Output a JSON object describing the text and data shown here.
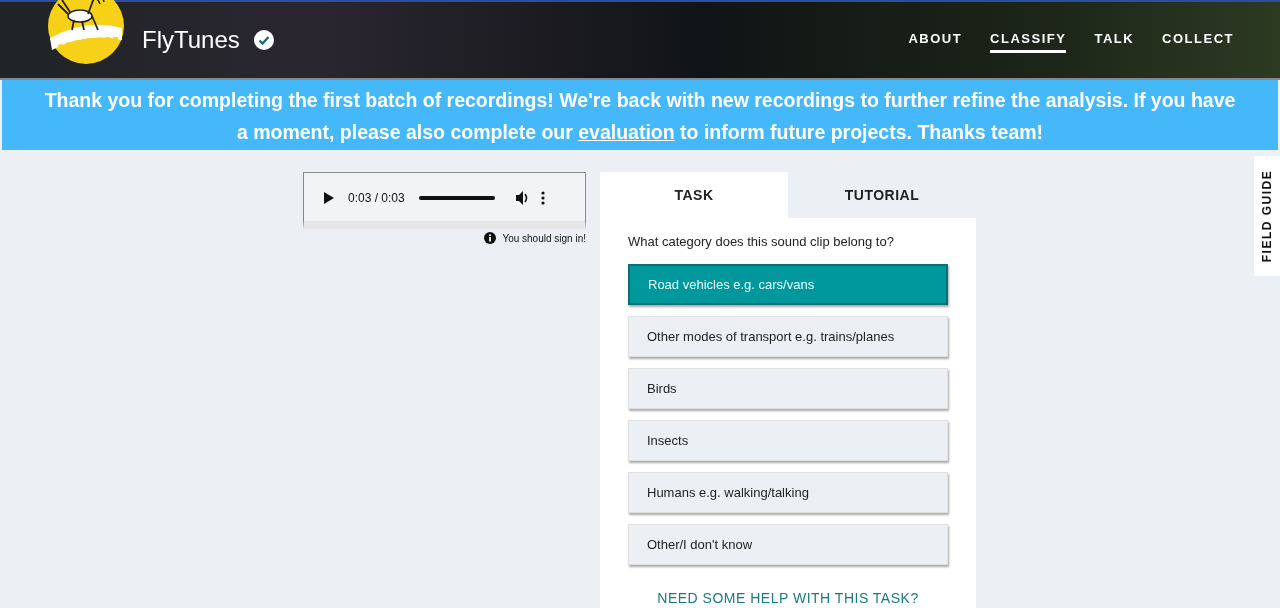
{
  "header": {
    "title": "FlyTunes",
    "verified": true,
    "nav": [
      {
        "label": "ABOUT",
        "selected": false
      },
      {
        "label": "CLASSIFY",
        "selected": true
      },
      {
        "label": "TALK",
        "selected": false
      },
      {
        "label": "COLLECT",
        "selected": false
      }
    ]
  },
  "banner": {
    "text_before": "Thank you for completing the first batch of recordings! We're back with new recordings to further refine the analysis. If you have a moment, please also complete our ",
    "link": "evaluation",
    "text_after": " to inform future projects. Thanks team!"
  },
  "audio_player": {
    "time": "0:03 / 0:03",
    "level": 1
  },
  "sign_in_note": "You should sign in!",
  "tabs": [
    {
      "label": "TASK",
      "selected": true
    },
    {
      "label": "TUTORIAL",
      "selected": false
    }
  ],
  "question": "What category does this sound clip belong to?",
  "answers": [
    {
      "label": "Road vehicles e.g. cars/vans",
      "selected": true
    },
    {
      "label": "Other modes of transport e.g. trains/planes",
      "selected": false
    },
    {
      "label": "Birds",
      "selected": false
    },
    {
      "label": "Insects",
      "selected": false
    },
    {
      "label": "Humans e.g. walking/talking",
      "selected": false
    },
    {
      "label": "Other/I don't know",
      "selected": false
    }
  ],
  "help_link": "NEED SOME HELP WITH THIS TASK?",
  "field_guide": "FIELD GUIDE"
}
